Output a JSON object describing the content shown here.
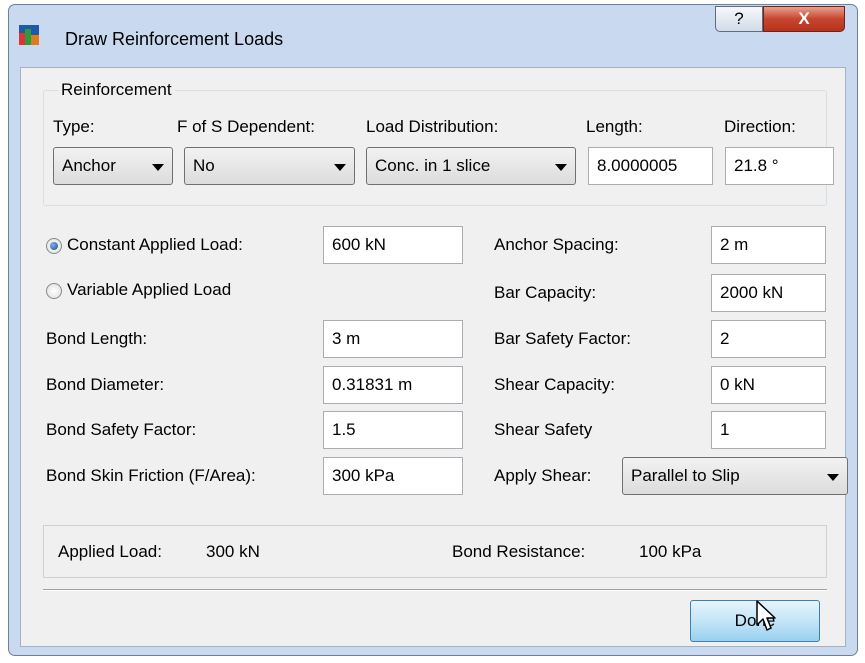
{
  "window": {
    "title": "Draw Reinforcement Loads",
    "help_label": "?",
    "close_label": "X"
  },
  "reinforcement": {
    "group_title": "Reinforcement",
    "type": {
      "label": "Type:",
      "value": "Anchor"
    },
    "fos_dependent": {
      "label": "F of S Dependent:",
      "value": "No"
    },
    "load_distribution": {
      "label": "Load Distribution:",
      "value": "Conc. in 1 slice"
    },
    "length": {
      "label": "Length:",
      "value": "8.0000005"
    },
    "direction": {
      "label": "Direction:",
      "value": "21.8 °"
    }
  },
  "left": {
    "constant_load": {
      "label": "Constant Applied Load:",
      "value": "600 kN",
      "selected": true
    },
    "variable_load": {
      "label": "Variable Applied Load",
      "selected": false
    },
    "bond_length": {
      "label": "Bond Length:",
      "value": "3 m"
    },
    "bond_diameter": {
      "label": "Bond Diameter:",
      "value": "0.31831 m"
    },
    "bond_safety_factor": {
      "label": "Bond Safety Factor:",
      "value": "1.5"
    },
    "bond_skin_friction": {
      "label": "Bond Skin Friction (F/Area):",
      "value": "300 kPa"
    }
  },
  "right": {
    "anchor_spacing": {
      "label": "Anchor Spacing:",
      "value": "2 m"
    },
    "bar_capacity": {
      "label": "Bar Capacity:",
      "value": "2000 kN"
    },
    "bar_safety_factor": {
      "label": "Bar Safety Factor:",
      "value": "2"
    },
    "shear_capacity": {
      "label": "Shear Capacity:",
      "value": "0 kN"
    },
    "shear_safety": {
      "label": "Shear Safety",
      "value": "1"
    },
    "apply_shear": {
      "label": "Apply Shear:",
      "value": "Parallel to Slip"
    }
  },
  "summary": {
    "applied_load_label": "Applied Load:",
    "applied_load_value": "300 kN",
    "bond_resistance_label": "Bond Resistance:",
    "bond_resistance_value": "100 kPa"
  },
  "buttons": {
    "done": "Done"
  }
}
